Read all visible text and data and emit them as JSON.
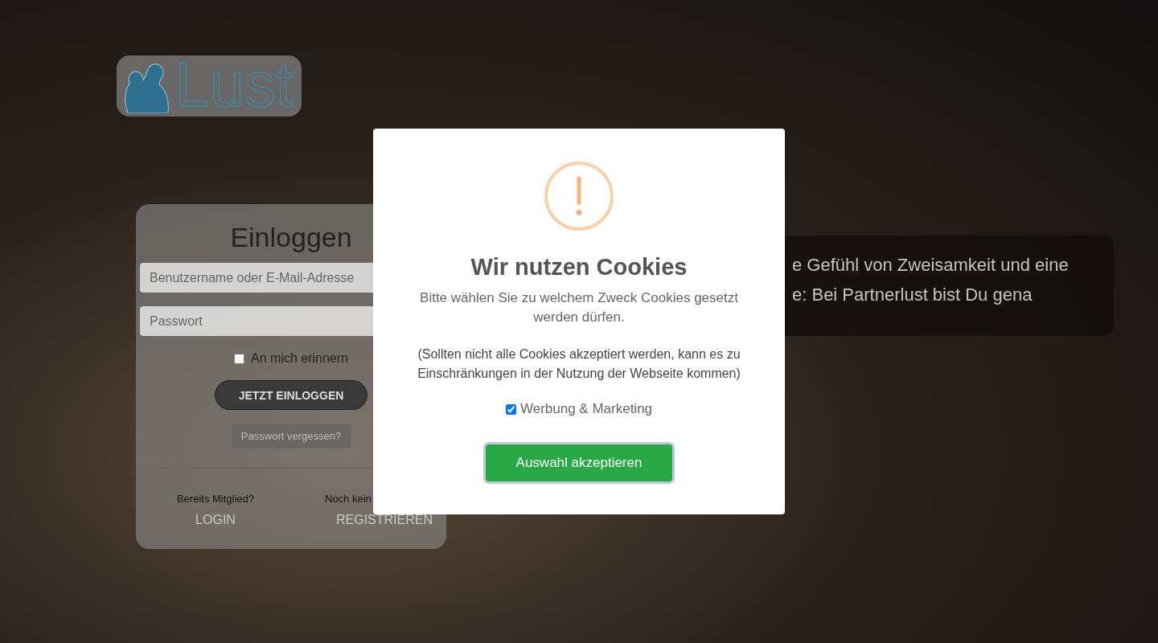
{
  "logo": {
    "text": "Lust"
  },
  "login": {
    "title": "Einloggen",
    "fields": [
      {
        "placeholder": "Benutzername oder E-Mail-Adresse"
      },
      {
        "placeholder": "Passwort"
      }
    ],
    "remember": {
      "label": "An mich erinnern",
      "checked": false
    },
    "submit": "JETZT EINLOGGEN",
    "forgot": "Passwort vergessen?",
    "links": [
      {
        "label": "Bereits Mitglied?",
        "link": "LOGIN"
      },
      {
        "label": "Noch kein",
        "link": "REGISTRIEREN"
      }
    ]
  },
  "intro": {
    "lines": [
      "e Gefühl von Zweisamkeit und eine",
      "e: Bei Partnerlust bist Du gena"
    ]
  },
  "cookie_dialog": {
    "title": "Wir nutzen Cookies",
    "text": "Bitte wählen Sie zu welchem Zweck Cookies gesetzt werden dürfen.",
    "note": "(Sollten nicht alle Cookies akzeptiert werden, kann es zu Einschränkungen in der Nutzung der Webseite kommen)",
    "options": [
      {
        "label": "Werbung & Marketing",
        "checked": true
      }
    ],
    "button": "Auswahl akzeptieren"
  }
}
